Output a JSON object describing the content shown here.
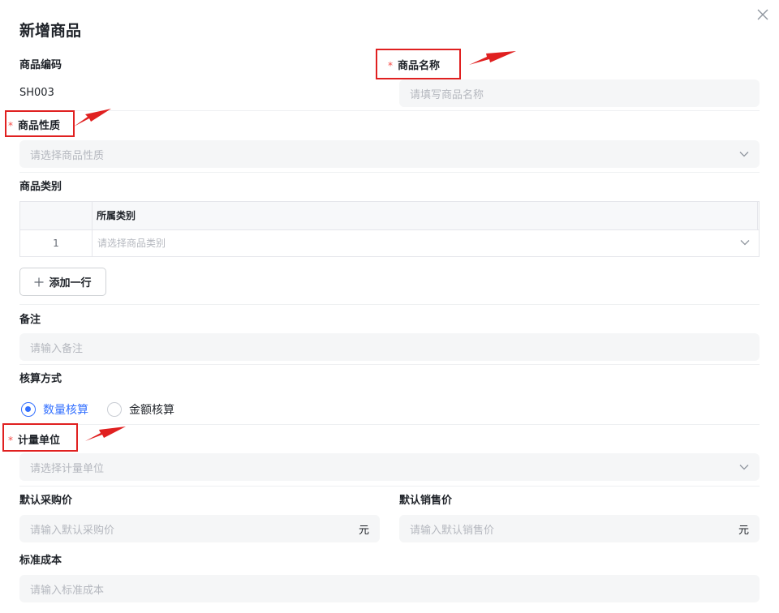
{
  "dialog": {
    "title": "新增商品"
  },
  "fields": {
    "product_code": {
      "label": "商品编码",
      "value": "SH003"
    },
    "product_name": {
      "label": "商品名称",
      "required_mark": "*",
      "placeholder": "请填写商品名称"
    },
    "product_nature": {
      "label": "商品性质",
      "required_mark": "*",
      "placeholder": "请选择商品性质"
    },
    "product_category": {
      "label": "商品类别",
      "column_header": "所属类别",
      "rows": [
        {
          "index": "1",
          "placeholder": "请选择商品类别"
        }
      ],
      "add_row_label": "添加一行"
    },
    "remark": {
      "label": "备注",
      "placeholder": "请输入备注"
    },
    "accounting_method": {
      "label": "核算方式",
      "options": [
        {
          "label": "数量核算",
          "checked": true
        },
        {
          "label": "金额核算",
          "checked": false
        }
      ]
    },
    "unit": {
      "label": "计量单位",
      "required_mark": "*",
      "placeholder": "请选择计量单位"
    },
    "default_purchase_price": {
      "label": "默认采购价",
      "placeholder": "请输入默认采购价",
      "suffix": "元"
    },
    "default_sale_price": {
      "label": "默认销售价",
      "placeholder": "请输入默认销售价",
      "suffix": "元"
    },
    "standard_cost": {
      "label": "标准成本",
      "placeholder": "请输入标准成本"
    }
  },
  "colors": {
    "accent": "#3370ff",
    "required": "#f54a45",
    "annotation": "#e02020"
  },
  "icons": {
    "close": "close-icon",
    "chevron": "chevron-down-icon",
    "plus": "plus-icon"
  }
}
